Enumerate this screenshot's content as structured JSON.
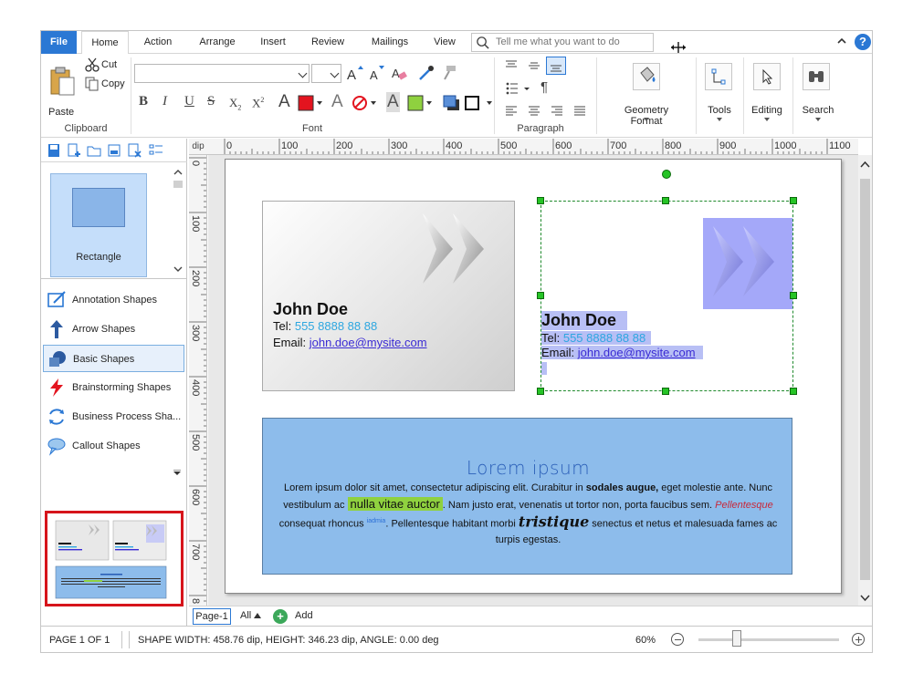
{
  "tabs": {
    "file": "File",
    "items": [
      "Home",
      "Action",
      "Arrange",
      "Insert",
      "Review",
      "Mailings",
      "View"
    ],
    "active": "Home",
    "tellme_placeholder": "Tell me what you want to do",
    "help": "?"
  },
  "ribbon": {
    "clipboard": {
      "paste": "Paste",
      "cut": "Cut",
      "copy": "Copy",
      "label": "Clipboard"
    },
    "font": {
      "label": "Font",
      "font_name": "",
      "font_size": ""
    },
    "paragraph": {
      "label": "Paragraph"
    },
    "geometry": {
      "label": "Geometry Format"
    },
    "tools": {
      "label": "Tools"
    },
    "editing": {
      "label": "Editing"
    },
    "search": {
      "label": "Search"
    }
  },
  "leftpane": {
    "selected_shape": "Rectangle",
    "categories": [
      "Annotation Shapes",
      "Arrow Shapes",
      "Basic Shapes",
      "Brainstorming Shapes",
      "Business Process Sha...",
      "Callout Shapes"
    ],
    "active_category": "Basic Shapes"
  },
  "ruler": {
    "unit": "dip",
    "top_ticks": [
      "0",
      "100",
      "200",
      "300",
      "400",
      "500",
      "600",
      "700",
      "800",
      "900",
      "1000",
      "1100"
    ],
    "left_ticks": [
      "0",
      "100",
      "200",
      "300",
      "400",
      "500",
      "600",
      "700",
      "8"
    ]
  },
  "canvas": {
    "card1": {
      "name": "John Doe",
      "tel_label": "Tel: ",
      "tel": "555 8888 88 88",
      "email_label": "Email: ",
      "email": "john.doe@mysite.com"
    },
    "card2": {
      "name": "John Doe",
      "tel_label": "Tel: ",
      "tel": "555 8888 88 88",
      "email_label": "Email: ",
      "email": "john.doe@mysite.com"
    },
    "lorem": {
      "title": "Lorem ipsum",
      "p1": "Lorem ipsum dolor sit amet, consectetur adipiscing elit. Curabitur in ",
      "p1_bold": "sodales augue,",
      "p2": " eget molestie ante. Nunc vestibulum ac ",
      "highlight": "nulla vitae auctor",
      "p3": ". Nam justo erat, venenatis ut tortor non, porta faucibus sem. ",
      "red_italic": "Pellentesque",
      "p4": "consequat rhoncus ",
      "sup": "iadmia",
      "p5": ". Pellentesque habitant morbi ",
      "tristique": "tristique",
      "p6": " senectus et netus et malesuada fames ac turpis egestas."
    }
  },
  "pagetabs": {
    "page": "Page-1",
    "all": "All",
    "add": "Add"
  },
  "status": {
    "page": "PAGE 1 OF 1",
    "shape": "SHAPE WIDTH: 458.76 dip, HEIGHT: 346.23 dip, ANGLE: 0.00 deg",
    "zoom": "60%",
    "zoom_fraction": 0.27
  },
  "colors": {
    "accent": "#2b78d4",
    "selection_handle": "#26c426",
    "lorem_bg": "#8dbceb",
    "preview_border": "#d6141b"
  }
}
